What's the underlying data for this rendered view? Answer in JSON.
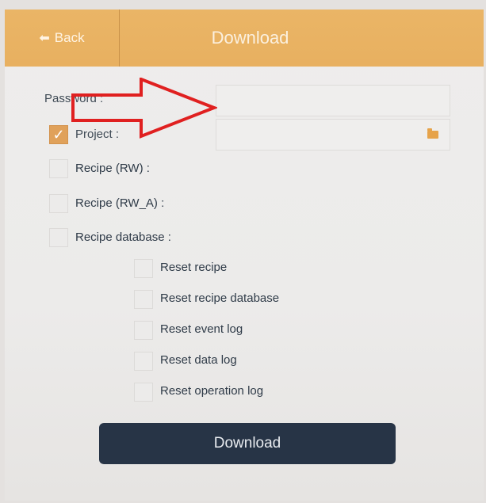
{
  "header": {
    "back_label": "Back",
    "title": "Download"
  },
  "form": {
    "password_label": "Password :",
    "password_value": "",
    "project_label": "Project :",
    "project_checked": true,
    "project_value": "",
    "options": [
      {
        "label": "Recipe (RW) :",
        "checked": false
      },
      {
        "label": "Recipe (RW_A) :",
        "checked": false
      },
      {
        "label": "Recipe database :",
        "checked": false
      }
    ],
    "reset_options": [
      {
        "label": "Reset recipe",
        "checked": false
      },
      {
        "label": "Reset recipe database",
        "checked": false
      },
      {
        "label": "Reset event log",
        "checked": false
      },
      {
        "label": "Reset data log",
        "checked": false
      },
      {
        "label": "Reset operation log",
        "checked": false
      }
    ]
  },
  "footer": {
    "download_label": "Download"
  },
  "icons": {
    "back": "arrow-left-icon",
    "folder": "folder-icon",
    "check": "check-icon"
  },
  "colors": {
    "header_bg": "#e8b060",
    "button_bg": "#273446",
    "checkbox_checked": "#e0a15a",
    "annotation_red": "#e02020"
  }
}
